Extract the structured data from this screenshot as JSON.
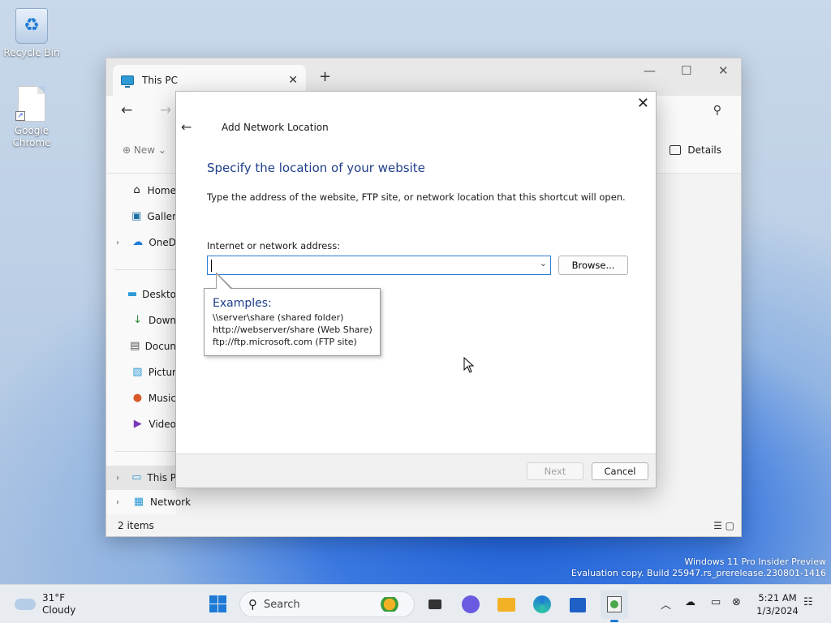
{
  "desktop": {
    "icons": [
      {
        "label": "Recycle Bin"
      },
      {
        "label": "Google Chrome"
      }
    ]
  },
  "explorer": {
    "tab_title": "This PC",
    "new_label": "New",
    "details_label": "Details",
    "sidebar": [
      {
        "label": "Home",
        "icon": "home-icon"
      },
      {
        "label": "Galler",
        "icon": "gallery-icon"
      },
      {
        "label": "OneD",
        "icon": "cloud-icon"
      },
      {
        "label": "Deskto",
        "icon": "desktop-icon"
      },
      {
        "label": "Down",
        "icon": "download-icon"
      },
      {
        "label": "Docun",
        "icon": "document-icon"
      },
      {
        "label": "Pictur",
        "icon": "pictures-icon"
      },
      {
        "label": "Music",
        "icon": "music-icon"
      },
      {
        "label": "Video",
        "icon": "video-icon"
      },
      {
        "label": "This P",
        "icon": "computer-icon"
      },
      {
        "label": "Network",
        "icon": "network-icon"
      }
    ],
    "status": "2 items"
  },
  "dialog": {
    "title": "Add Network Location",
    "heading": "Specify the location of your website",
    "description": "Type the address of the website, FTP site, or network location that this shortcut will open.",
    "address_label": "Internet or network address:",
    "address_value": "",
    "browse_label": "Browse...",
    "tooltip": {
      "title": "Examples:",
      "lines": [
        "\\\\server\\share   (shared folder)",
        "http://webserver/share   (Web Share)",
        "ftp://ftp.microsoft.com   (FTP site)"
      ]
    },
    "next_label": "Next",
    "cancel_label": "Cancel"
  },
  "watermark": {
    "line1": "Windows 11 Pro Insider Preview",
    "line2": "Evaluation copy. Build 25947.rs_prerelease.230801-1416"
  },
  "taskbar": {
    "weather_temp": "31°F",
    "weather_desc": "Cloudy",
    "search_label": "Search",
    "time": "5:21 AM",
    "date": "1/3/2024"
  },
  "colors": {
    "accent": "#1e7ad6",
    "heading_blue": "#1e3f8a"
  }
}
